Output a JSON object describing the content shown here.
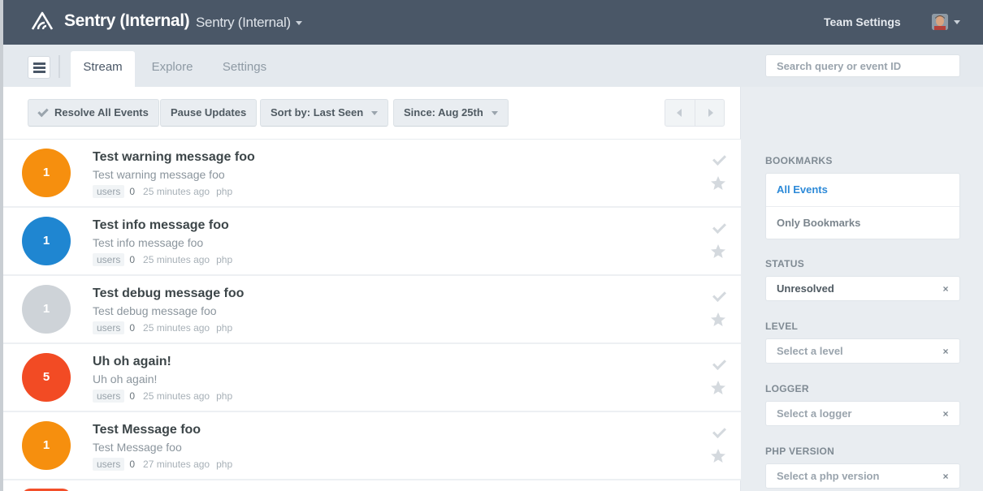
{
  "header": {
    "brand": "Sentry (Internal)",
    "org_switcher": "Sentry (Internal)",
    "team_settings": "Team Settings"
  },
  "tabs": [
    {
      "label": "Stream",
      "active": true
    },
    {
      "label": "Explore",
      "active": false
    },
    {
      "label": "Settings",
      "active": false
    }
  ],
  "search": {
    "placeholder": "Search query or event ID",
    "value": ""
  },
  "toolbar": {
    "resolve_all": "Resolve All Events",
    "pause_updates": "Pause Updates",
    "sort_by": "Sort by: Last Seen",
    "since": "Since: Aug 25th"
  },
  "events": [
    {
      "count": "1",
      "title": "Test warning message foo",
      "message": "Test warning message foo",
      "users_label": "users",
      "users": "0",
      "time": "25 minutes ago",
      "platform": "php",
      "level_color": "#f68f0e"
    },
    {
      "count": "1",
      "title": "Test info message foo",
      "message": "Test info message foo",
      "users_label": "users",
      "users": "0",
      "time": "25 minutes ago",
      "platform": "php",
      "level_color": "#1f86d1"
    },
    {
      "count": "1",
      "title": "Test debug message foo",
      "message": "Test debug message foo",
      "users_label": "users",
      "users": "0",
      "time": "25 minutes ago",
      "platform": "php",
      "level_color": "#ced3d8"
    },
    {
      "count": "5",
      "title": "Uh oh again!",
      "message": "Uh oh again!",
      "users_label": "users",
      "users": "0",
      "time": "25 minutes ago",
      "platform": "php",
      "level_color": "#f24b24"
    },
    {
      "count": "1",
      "title": "Test Message foo",
      "message": "Test Message foo",
      "users_label": "users",
      "users": "0",
      "time": "27 minutes ago",
      "platform": "php",
      "level_color": "#f68f0e"
    }
  ],
  "sidebar": {
    "bookmarks_label": "BOOKMARKS",
    "bookmarks": [
      {
        "label": "All Events",
        "active": true
      },
      {
        "label": "Only Bookmarks",
        "active": false
      }
    ],
    "status_label": "STATUS",
    "status_value": "Unresolved",
    "level_label": "LEVEL",
    "level_placeholder": "Select a level",
    "logger_label": "LOGGER",
    "logger_placeholder": "Select a logger",
    "php_version_label": "PHP VERSION",
    "php_version_placeholder": "Select a php version",
    "clear_glyph": "×"
  },
  "colors": {
    "header_bg": "#4a5767",
    "accent_blue": "#2d8ad8",
    "next_row_level": "#f34f2a"
  }
}
